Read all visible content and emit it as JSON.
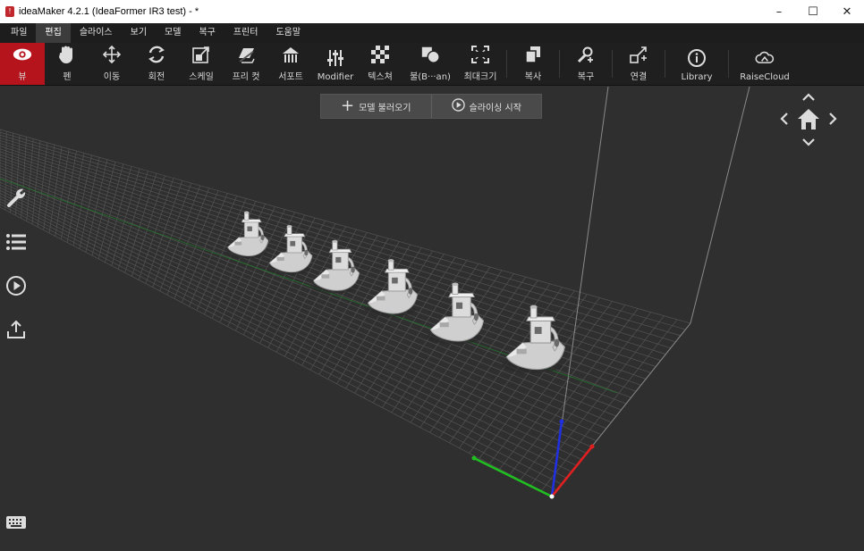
{
  "window": {
    "title": "ideaMaker 4.2.1 (IdeaFormer IR3 test) - *",
    "minimize": "–",
    "maximize": "☐",
    "close": "✕"
  },
  "menu": [
    "파일",
    "편집",
    "슬라이스",
    "보기",
    "모델",
    "복구",
    "프린터",
    "도움말"
  ],
  "menu_active": "편집",
  "toolbar": {
    "view": "뷰",
    "pan": "펜",
    "move": "이동",
    "rotate": "회전",
    "scale": "스케일",
    "cut": "프리 컷",
    "support": "서포트",
    "modifier": "Modifier",
    "texture": "텍스쳐",
    "boolean": "불(B···an)",
    "maximize": "최대크기",
    "copy": "복사",
    "repair": "복구",
    "connect": "연결",
    "library": "Library",
    "raisecloud": "RaiseCloud"
  },
  "viewport": {
    "load_model": "모델 불러오기",
    "start_slicing": "슬라이싱 시작"
  },
  "colors": {
    "active_tool": "#b5141c",
    "background": "#2f2f2f",
    "grid": "#5a5a5a",
    "axis_x": "#e02020",
    "axis_y": "#20c020",
    "axis_z": "#2030e0"
  }
}
